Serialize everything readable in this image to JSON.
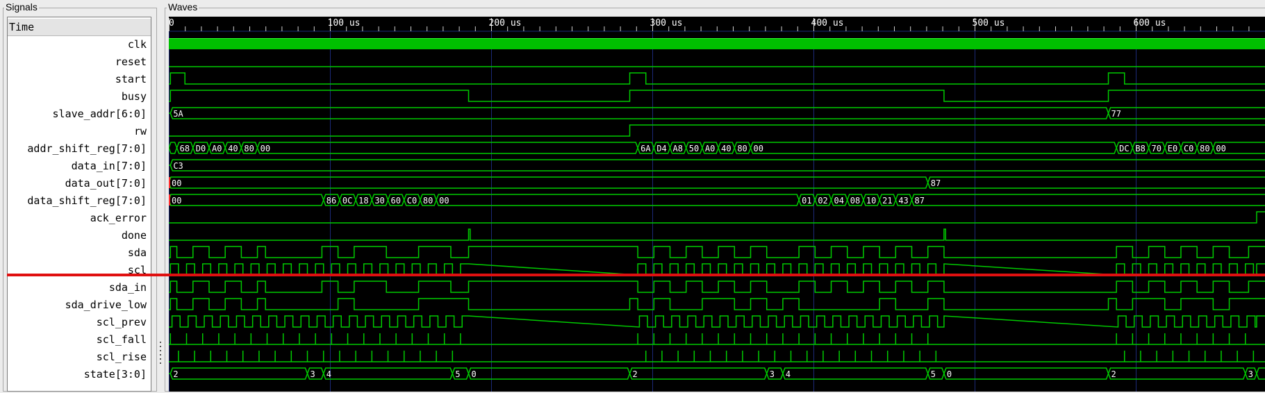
{
  "panels": {
    "signals_label": "Signals",
    "waves_label": "Waves"
  },
  "time_axis": {
    "label": "Time",
    "unit": "us",
    "start": 0,
    "end": 675,
    "ticks": [
      {
        "value": 0,
        "label": "0"
      },
      {
        "value": 100,
        "label": "100 us"
      },
      {
        "value": 200,
        "label": "200 us"
      },
      {
        "value": 300,
        "label": "300 us"
      },
      {
        "value": 400,
        "label": "400 us"
      },
      {
        "value": 500,
        "label": "500 us"
      },
      {
        "value": 600,
        "label": "600 us"
      }
    ]
  },
  "colors": {
    "wave": "#00cc00",
    "clock_fill": "#00c000",
    "background": "#000000",
    "grid": "#1c2a78",
    "marker": "#e01010",
    "x_value": "#ff3030"
  },
  "signals": [
    {
      "name": "clk",
      "kind": "clock"
    },
    {
      "name": "reset",
      "kind": "bit",
      "init": 0,
      "edges": []
    },
    {
      "name": "start",
      "kind": "bit",
      "init": 0,
      "edges": [
        1,
        10,
        286,
        296,
        583,
        593
      ]
    },
    {
      "name": "busy",
      "kind": "bit",
      "init": 0,
      "edges": [
        1,
        186,
        286,
        481,
        583
      ]
    },
    {
      "name": "slave_addr[6:0]",
      "kind": "bus",
      "segments": [
        {
          "t": 1,
          "v": "5A"
        },
        {
          "t": 583,
          "v": "77"
        }
      ]
    },
    {
      "name": "rw",
      "kind": "bit",
      "init": 0,
      "edges": [
        286
      ]
    },
    {
      "name": "addr_shift_reg[7:0]",
      "kind": "bus",
      "segments": [
        {
          "t": 0,
          "v": ""
        },
        {
          "t": 5,
          "v": "68"
        },
        {
          "t": 15,
          "v": "D0"
        },
        {
          "t": 25,
          "v": "A0"
        },
        {
          "t": 35,
          "v": "40"
        },
        {
          "t": 45,
          "v": "80"
        },
        {
          "t": 55,
          "v": "00"
        },
        {
          "t": 291,
          "v": "6A"
        },
        {
          "t": 301,
          "v": "D4"
        },
        {
          "t": 311,
          "v": "A8"
        },
        {
          "t": 321,
          "v": "50"
        },
        {
          "t": 331,
          "v": "A0"
        },
        {
          "t": 341,
          "v": "40"
        },
        {
          "t": 351,
          "v": "80"
        },
        {
          "t": 361,
          "v": "00"
        },
        {
          "t": 588,
          "v": "DC"
        },
        {
          "t": 598,
          "v": "B8"
        },
        {
          "t": 608,
          "v": "70"
        },
        {
          "t": 618,
          "v": "E0"
        },
        {
          "t": 628,
          "v": "C0"
        },
        {
          "t": 638,
          "v": "80"
        },
        {
          "t": 648,
          "v": "00"
        }
      ]
    },
    {
      "name": "data_in[7:0]",
      "kind": "bus",
      "segments": [
        {
          "t": 1,
          "v": "C3"
        }
      ]
    },
    {
      "name": "data_out[7:0]",
      "kind": "bus",
      "segments": [
        {
          "t": 0,
          "v": "00",
          "x_start": true
        },
        {
          "t": 471,
          "v": "87"
        }
      ]
    },
    {
      "name": "data_shift_reg[7:0]",
      "kind": "bus",
      "segments": [
        {
          "t": 0,
          "v": "00",
          "x_start": true
        },
        {
          "t": 96,
          "v": "86"
        },
        {
          "t": 106,
          "v": "0C"
        },
        {
          "t": 116,
          "v": "18"
        },
        {
          "t": 126,
          "v": "30"
        },
        {
          "t": 136,
          "v": "60"
        },
        {
          "t": 146,
          "v": "C0"
        },
        {
          "t": 156,
          "v": "80"
        },
        {
          "t": 166,
          "v": "00"
        },
        {
          "t": 391,
          "v": "01"
        },
        {
          "t": 401,
          "v": "02"
        },
        {
          "t": 411,
          "v": "04"
        },
        {
          "t": 421,
          "v": "08"
        },
        {
          "t": 431,
          "v": "10"
        },
        {
          "t": 441,
          "v": "21"
        },
        {
          "t": 451,
          "v": "43"
        },
        {
          "t": 461,
          "v": "87"
        }
      ]
    },
    {
      "name": "ack_error",
      "kind": "bit",
      "init": 0,
      "edges": [
        675
      ]
    },
    {
      "name": "done",
      "kind": "bit",
      "init": 0,
      "edges": [
        186,
        187,
        481,
        482
      ]
    },
    {
      "name": "sda",
      "kind": "bit",
      "init": 0,
      "edges": [
        1,
        5,
        15,
        25,
        35,
        45,
        55,
        60,
        95,
        105,
        115,
        135,
        155,
        175,
        186,
        291,
        301,
        311,
        321,
        331,
        341,
        351,
        361,
        371,
        391,
        401,
        411,
        421,
        431,
        441,
        451,
        461,
        471,
        481,
        588,
        598,
        608,
        618,
        628,
        638,
        648,
        658,
        670
      ]
    },
    {
      "name": "scl",
      "kind": "clockish",
      "init": 1,
      "period": 10,
      "ranges": [
        [
          1,
          186
        ],
        [
          291,
          481
        ],
        [
          588,
          675
        ]
      ]
    },
    {
      "name": "sda_in",
      "kind": "bit",
      "init": 0,
      "edges": [
        1,
        5,
        15,
        25,
        35,
        45,
        55,
        60,
        95,
        105,
        115,
        135,
        155,
        175,
        186,
        291,
        301,
        311,
        321,
        331,
        341,
        351,
        361,
        371,
        391,
        401,
        411,
        421,
        431,
        441,
        451,
        461,
        471,
        481,
        588,
        598,
        608,
        618,
        628,
        638,
        648,
        658,
        670
      ]
    },
    {
      "name": "sda_drive_low",
      "kind": "bit",
      "init": 0,
      "edges": [
        1,
        5,
        15,
        25,
        35,
        45,
        55,
        60,
        105,
        115,
        155,
        186,
        286,
        291,
        301,
        311,
        331,
        351,
        361,
        371,
        381,
        391,
        441,
        451,
        471,
        481,
        583,
        588,
        598,
        618,
        628,
        648,
        658
      ]
    },
    {
      "name": "scl_prev",
      "kind": "clockish",
      "init": 1,
      "period": 10,
      "ranges": [
        [
          2,
          186
        ],
        [
          292,
          481
        ],
        [
          589,
          675
        ]
      ]
    },
    {
      "name": "scl_fall",
      "kind": "pulses",
      "start": 1,
      "step": 10,
      "ranges": [
        [
          1,
          186
        ],
        [
          291,
          481
        ],
        [
          588,
          675
        ]
      ]
    },
    {
      "name": "scl_rise",
      "kind": "pulses",
      "start": 6,
      "step": 10,
      "ranges": [
        [
          6,
          186
        ],
        [
          296,
          481
        ],
        [
          593,
          675
        ]
      ]
    },
    {
      "name": "state[3:0]",
      "kind": "bus",
      "segments": [
        {
          "t": 1,
          "v": "2"
        },
        {
          "t": 86,
          "v": "3"
        },
        {
          "t": 96,
          "v": "4"
        },
        {
          "t": 176,
          "v": "5"
        },
        {
          "t": 186,
          "v": "0"
        },
        {
          "t": 286,
          "v": "2"
        },
        {
          "t": 371,
          "v": "3"
        },
        {
          "t": 381,
          "v": "4"
        },
        {
          "t": 471,
          "v": "5"
        },
        {
          "t": 481,
          "v": "0"
        },
        {
          "t": 583,
          "v": "2"
        },
        {
          "t": 668,
          "v": "3"
        },
        {
          "t": 675,
          "v": ""
        }
      ]
    }
  ]
}
